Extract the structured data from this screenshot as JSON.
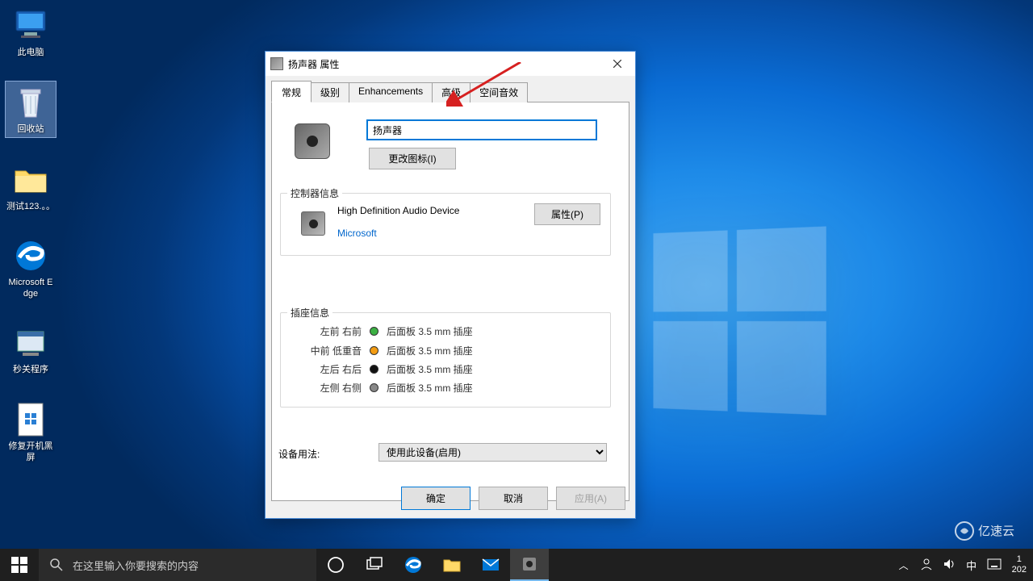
{
  "desktop": {
    "icons": [
      {
        "label": "此电脑"
      },
      {
        "label": "回收站"
      },
      {
        "label": "测试123.。。"
      },
      {
        "label": "Microsoft Edge"
      },
      {
        "label": "秒关程序"
      },
      {
        "label": "修复开机黑屏"
      }
    ]
  },
  "dialog": {
    "title": "扬声器 属性",
    "tabs": {
      "general": "常规",
      "levels": "级别",
      "enhancements": "Enhancements",
      "advanced": "高级",
      "spatial": "空间音效"
    },
    "device_name": "扬声器",
    "change_icon_btn": "更改图标(I)",
    "controller": {
      "legend": "控制器信息",
      "name": "High Definition Audio Device",
      "vendor": "Microsoft",
      "prop_btn": "属性(P)"
    },
    "jacks": {
      "legend": "插座信息",
      "rows": [
        {
          "label": "左前 右前",
          "desc": "后面板 3.5 mm 插座"
        },
        {
          "label": "中前 低重音",
          "desc": "后面板 3.5 mm 插座"
        },
        {
          "label": "左后 右后",
          "desc": "后面板 3.5 mm 插座"
        },
        {
          "label": "左侧 右侧",
          "desc": "后面板 3.5 mm 插座"
        }
      ]
    },
    "usage_label": "设备用法:",
    "usage_value": "使用此设备(启用)",
    "buttons": {
      "ok": "确定",
      "cancel": "取消",
      "apply": "应用(A)"
    }
  },
  "taskbar": {
    "search_placeholder": "在这里输入你要搜索的内容",
    "ime": "中",
    "clock_time": "1",
    "clock_date": "202"
  },
  "watermark": "亿速云"
}
